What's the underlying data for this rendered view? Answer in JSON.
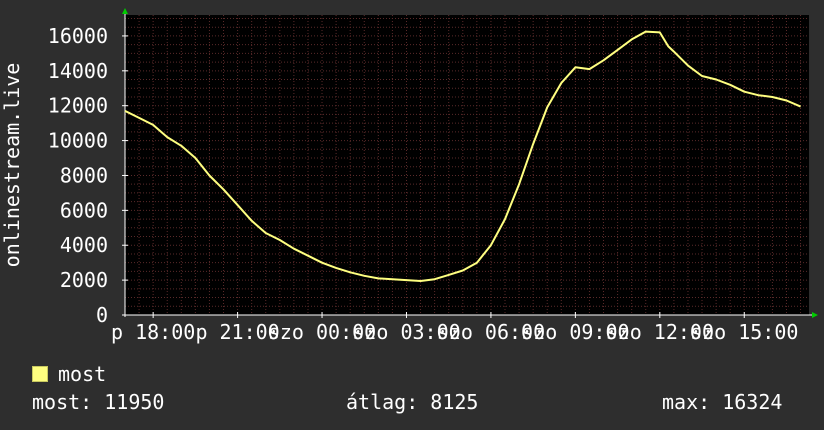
{
  "chart_data": {
    "type": "line",
    "title": "",
    "ylabel": "onlinestream.live",
    "xlabel": "",
    "ylim": [
      0,
      17200
    ],
    "grid": true,
    "colors": {
      "background": "#2e2e2e",
      "plot_bg": "#000000",
      "line": "#ffff80",
      "grid": "#5a2a2a"
    },
    "y_ticks": [
      0,
      2000,
      4000,
      6000,
      8000,
      10000,
      12000,
      14000,
      16000
    ],
    "x_tick_labels": [
      "p 18:00",
      "p 21:00",
      "szo 00:00",
      "szo 03:00",
      "szo 06:00",
      "szo 09:00",
      "szo 12:00",
      "szo 15:00"
    ],
    "x_tick_hours": [
      1,
      4,
      7,
      10,
      13,
      16,
      19,
      22
    ],
    "x_range_hours": [
      0,
      24.3
    ],
    "series": [
      {
        "name": "most",
        "x": [
          0,
          0.5,
          1,
          1.5,
          2,
          2.5,
          3,
          3.5,
          4,
          4.5,
          5,
          5.5,
          6,
          6.5,
          7,
          7.5,
          8,
          8.5,
          9,
          9.5,
          10,
          10.5,
          11,
          11.5,
          12,
          12.5,
          13,
          13.5,
          14,
          14.5,
          15,
          15.5,
          16,
          16.5,
          17,
          17.5,
          18,
          18.5,
          19,
          19.3,
          19.5,
          20,
          20.5,
          21,
          21.5,
          22,
          22.5,
          23,
          23.5,
          24
        ],
        "y": [
          11700,
          11300,
          10900,
          10200,
          9700,
          9000,
          8000,
          7200,
          6300,
          5400,
          4700,
          4300,
          3800,
          3400,
          3000,
          2700,
          2450,
          2250,
          2100,
          2050,
          2000,
          1950,
          2050,
          2300,
          2550,
          3000,
          4000,
          5500,
          7500,
          9800,
          11900,
          13300,
          14200,
          14100,
          14600,
          15200,
          15800,
          16250,
          16200,
          15400,
          15100,
          14300,
          13700,
          13500,
          13200,
          12800,
          12600,
          12500,
          12300,
          11950
        ]
      }
    ]
  },
  "legend": {
    "label": "most"
  },
  "stats": {
    "current": "most: 11950",
    "average": "átlag: 8125",
    "max": "max: 16324"
  }
}
